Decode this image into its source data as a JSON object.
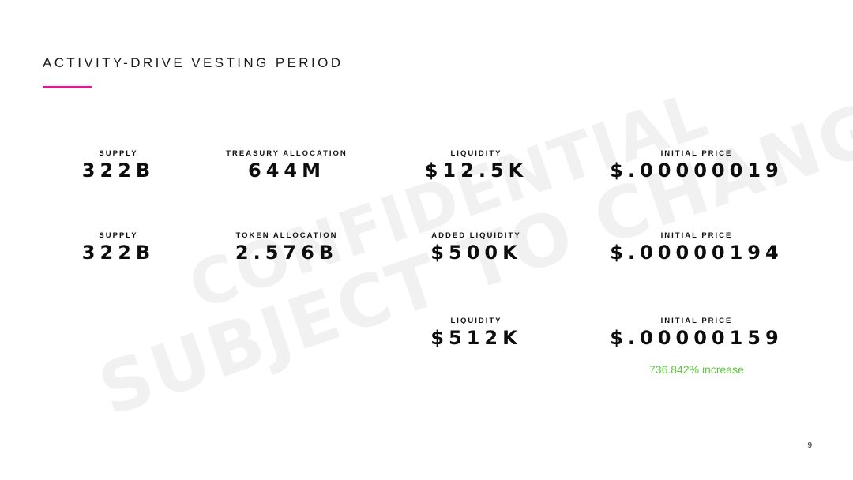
{
  "slide": {
    "title": "ACTIVITY-DRIVE VESTING PERIOD",
    "accent_color": "#e6168c",
    "page_number": "9"
  },
  "watermark": {
    "line1": "CONFIDENTIAL",
    "line2": "SUBJECT TO CHANGE"
  },
  "rows": [
    {
      "supply": {
        "label": "SUPPLY",
        "value": "322B"
      },
      "allocation": {
        "label": "TREASURY ALLOCATION",
        "value": "644M"
      },
      "liquidity": {
        "label": "LIQUIDITY",
        "value": "$12.5K"
      },
      "price": {
        "label": "INITIAL PRICE",
        "value": "$.00000019"
      }
    },
    {
      "supply": {
        "label": "SUPPLY",
        "value": "322B"
      },
      "allocation": {
        "label": "TOKEN ALLOCATION",
        "value": "2.576B"
      },
      "liquidity": {
        "label": "ADDED LIQUIDITY",
        "value": "$500K"
      },
      "price": {
        "label": "INITIAL PRICE",
        "value": "$.00000194"
      }
    },
    {
      "liquidity": {
        "label": "LIQUIDITY",
        "value": "$512K"
      },
      "price": {
        "label": "INITIAL PRICE",
        "value": "$.00000159"
      },
      "note": {
        "text": "736.842% increase",
        "color": "#5ec93f"
      }
    }
  ]
}
